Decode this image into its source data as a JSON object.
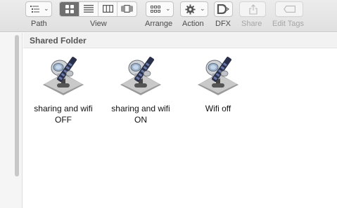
{
  "toolbar": {
    "path_label": "Path",
    "view_label": "View",
    "arrange_label": "Arrange",
    "action_label": "Action",
    "dfx_label": "DFX",
    "share_label": "Share",
    "edit_tags_label": "Edit Tags"
  },
  "section": {
    "title": "Shared Folder"
  },
  "files": [
    {
      "name": "sharing and wifi\nOFF",
      "icon": "automator-icon"
    },
    {
      "name": "sharing and wifi\nON",
      "icon": "automator-icon"
    },
    {
      "name": "Wifi off",
      "icon": "automator-icon"
    }
  ]
}
